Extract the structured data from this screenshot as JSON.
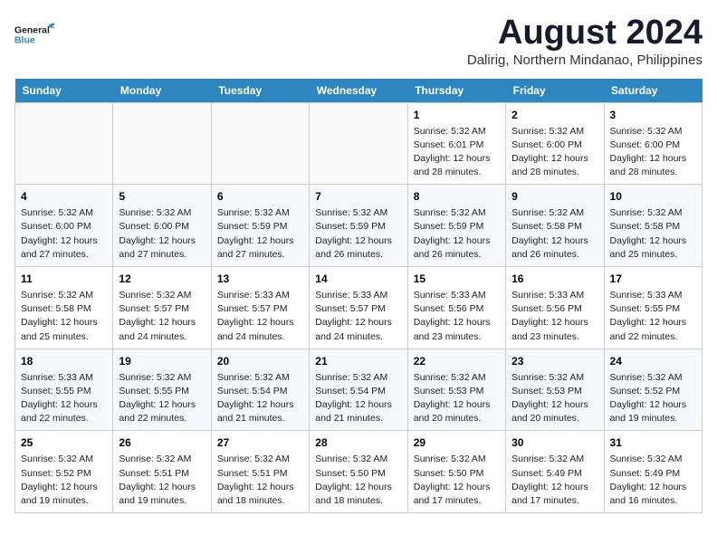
{
  "header": {
    "logo_general": "General",
    "logo_blue": "Blue",
    "month_year": "August 2024",
    "location": "Dalirig, Northern Mindanao, Philippines"
  },
  "columns": [
    "Sunday",
    "Monday",
    "Tuesday",
    "Wednesday",
    "Thursday",
    "Friday",
    "Saturday"
  ],
  "weeks": [
    [
      {
        "day": "",
        "info": ""
      },
      {
        "day": "",
        "info": ""
      },
      {
        "day": "",
        "info": ""
      },
      {
        "day": "",
        "info": ""
      },
      {
        "day": "1",
        "info": "Sunrise: 5:32 AM\nSunset: 6:01 PM\nDaylight: 12 hours\nand 28 minutes."
      },
      {
        "day": "2",
        "info": "Sunrise: 5:32 AM\nSunset: 6:00 PM\nDaylight: 12 hours\nand 28 minutes."
      },
      {
        "day": "3",
        "info": "Sunrise: 5:32 AM\nSunset: 6:00 PM\nDaylight: 12 hours\nand 28 minutes."
      }
    ],
    [
      {
        "day": "4",
        "info": "Sunrise: 5:32 AM\nSunset: 6:00 PM\nDaylight: 12 hours\nand 27 minutes."
      },
      {
        "day": "5",
        "info": "Sunrise: 5:32 AM\nSunset: 6:00 PM\nDaylight: 12 hours\nand 27 minutes."
      },
      {
        "day": "6",
        "info": "Sunrise: 5:32 AM\nSunset: 5:59 PM\nDaylight: 12 hours\nand 27 minutes."
      },
      {
        "day": "7",
        "info": "Sunrise: 5:32 AM\nSunset: 5:59 PM\nDaylight: 12 hours\nand 26 minutes."
      },
      {
        "day": "8",
        "info": "Sunrise: 5:32 AM\nSunset: 5:59 PM\nDaylight: 12 hours\nand 26 minutes."
      },
      {
        "day": "9",
        "info": "Sunrise: 5:32 AM\nSunset: 5:58 PM\nDaylight: 12 hours\nand 26 minutes."
      },
      {
        "day": "10",
        "info": "Sunrise: 5:32 AM\nSunset: 5:58 PM\nDaylight: 12 hours\nand 25 minutes."
      }
    ],
    [
      {
        "day": "11",
        "info": "Sunrise: 5:32 AM\nSunset: 5:58 PM\nDaylight: 12 hours\nand 25 minutes."
      },
      {
        "day": "12",
        "info": "Sunrise: 5:32 AM\nSunset: 5:57 PM\nDaylight: 12 hours\nand 24 minutes."
      },
      {
        "day": "13",
        "info": "Sunrise: 5:33 AM\nSunset: 5:57 PM\nDaylight: 12 hours\nand 24 minutes."
      },
      {
        "day": "14",
        "info": "Sunrise: 5:33 AM\nSunset: 5:57 PM\nDaylight: 12 hours\nand 24 minutes."
      },
      {
        "day": "15",
        "info": "Sunrise: 5:33 AM\nSunset: 5:56 PM\nDaylight: 12 hours\nand 23 minutes."
      },
      {
        "day": "16",
        "info": "Sunrise: 5:33 AM\nSunset: 5:56 PM\nDaylight: 12 hours\nand 23 minutes."
      },
      {
        "day": "17",
        "info": "Sunrise: 5:33 AM\nSunset: 5:55 PM\nDaylight: 12 hours\nand 22 minutes."
      }
    ],
    [
      {
        "day": "18",
        "info": "Sunrise: 5:33 AM\nSunset: 5:55 PM\nDaylight: 12 hours\nand 22 minutes."
      },
      {
        "day": "19",
        "info": "Sunrise: 5:32 AM\nSunset: 5:55 PM\nDaylight: 12 hours\nand 22 minutes."
      },
      {
        "day": "20",
        "info": "Sunrise: 5:32 AM\nSunset: 5:54 PM\nDaylight: 12 hours\nand 21 minutes."
      },
      {
        "day": "21",
        "info": "Sunrise: 5:32 AM\nSunset: 5:54 PM\nDaylight: 12 hours\nand 21 minutes."
      },
      {
        "day": "22",
        "info": "Sunrise: 5:32 AM\nSunset: 5:53 PM\nDaylight: 12 hours\nand 20 minutes."
      },
      {
        "day": "23",
        "info": "Sunrise: 5:32 AM\nSunset: 5:53 PM\nDaylight: 12 hours\nand 20 minutes."
      },
      {
        "day": "24",
        "info": "Sunrise: 5:32 AM\nSunset: 5:52 PM\nDaylight: 12 hours\nand 19 minutes."
      }
    ],
    [
      {
        "day": "25",
        "info": "Sunrise: 5:32 AM\nSunset: 5:52 PM\nDaylight: 12 hours\nand 19 minutes."
      },
      {
        "day": "26",
        "info": "Sunrise: 5:32 AM\nSunset: 5:51 PM\nDaylight: 12 hours\nand 19 minutes."
      },
      {
        "day": "27",
        "info": "Sunrise: 5:32 AM\nSunset: 5:51 PM\nDaylight: 12 hours\nand 18 minutes."
      },
      {
        "day": "28",
        "info": "Sunrise: 5:32 AM\nSunset: 5:50 PM\nDaylight: 12 hours\nand 18 minutes."
      },
      {
        "day": "29",
        "info": "Sunrise: 5:32 AM\nSunset: 5:50 PM\nDaylight: 12 hours\nand 17 minutes."
      },
      {
        "day": "30",
        "info": "Sunrise: 5:32 AM\nSunset: 5:49 PM\nDaylight: 12 hours\nand 17 minutes."
      },
      {
        "day": "31",
        "info": "Sunrise: 5:32 AM\nSunset: 5:49 PM\nDaylight: 12 hours\nand 16 minutes."
      }
    ]
  ]
}
